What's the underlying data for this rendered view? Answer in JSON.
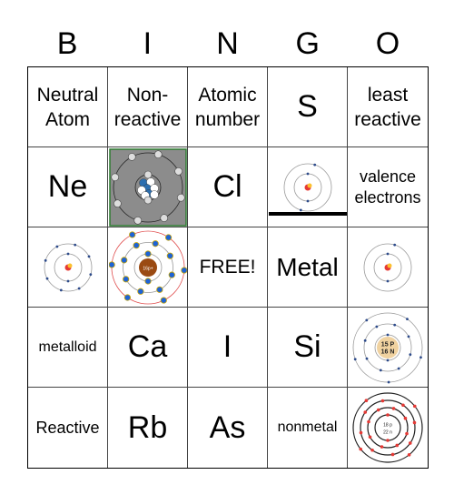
{
  "header": {
    "letters": [
      "B",
      "I",
      "N",
      "G",
      "O"
    ]
  },
  "cells": [
    {
      "type": "text",
      "text": "Neutral Atom",
      "size": "t-m"
    },
    {
      "type": "text",
      "text": "Non-reactive",
      "size": "t-m"
    },
    {
      "type": "text",
      "text": "Atomic number",
      "size": "t-m"
    },
    {
      "type": "text",
      "text": "S",
      "size": "t-xl"
    },
    {
      "type": "text",
      "text": "least reactive",
      "size": "t-m"
    },
    {
      "type": "text",
      "text": "Ne",
      "size": "t-xl"
    },
    {
      "type": "image",
      "image": "atom-model-gray-3d",
      "nucleus": "",
      "style": "gray",
      "shells": [
        2,
        8
      ]
    },
    {
      "type": "text",
      "text": "Cl",
      "size": "t-xl"
    },
    {
      "type": "image",
      "image": "atom-diagram-lithium",
      "nucleus": "",
      "style": "flat",
      "shells": [
        2,
        2
      ]
    },
    {
      "type": "text",
      "text": "valence electrons",
      "size": "t-s"
    },
    {
      "type": "image",
      "image": "atom-diagram-pairs",
      "nucleus": "",
      "style": "flat",
      "shells": [
        2,
        8
      ]
    },
    {
      "type": "image",
      "image": "atom-model-sulfur-3d",
      "nucleus": "16p+",
      "style": "gold",
      "shells": [
        2,
        8,
        6
      ]
    },
    {
      "type": "text",
      "text": "FREE!",
      "size": "t-m"
    },
    {
      "type": "text",
      "text": "Metal",
      "size": "t-l"
    },
    {
      "type": "image",
      "image": "atom-diagram-small",
      "nucleus": "",
      "style": "flat",
      "shells": [
        2,
        1
      ]
    },
    {
      "type": "text",
      "text": "metalloid",
      "size": "t-xs"
    },
    {
      "type": "text",
      "text": "Ca",
      "size": "t-xl"
    },
    {
      "type": "text",
      "text": "I",
      "size": "t-xl"
    },
    {
      "type": "text",
      "text": "Si",
      "size": "t-xl"
    },
    {
      "type": "image",
      "image": "atom-diagram-phosphorus",
      "nucleus": "15 P 16 N",
      "style": "phos",
      "shells": [
        2,
        8,
        5
      ]
    },
    {
      "type": "text",
      "text": "Reactive",
      "size": "t-s"
    },
    {
      "type": "text",
      "text": "Rb",
      "size": "t-xl"
    },
    {
      "type": "text",
      "text": "As",
      "size": "t-xl"
    },
    {
      "type": "text",
      "text": "nonmetal",
      "size": "t-xs"
    },
    {
      "type": "image",
      "image": "atom-diagram-argon",
      "nucleus": "18 p 22 n",
      "style": "red",
      "shells": [
        2,
        8,
        8,
        4
      ]
    }
  ]
}
